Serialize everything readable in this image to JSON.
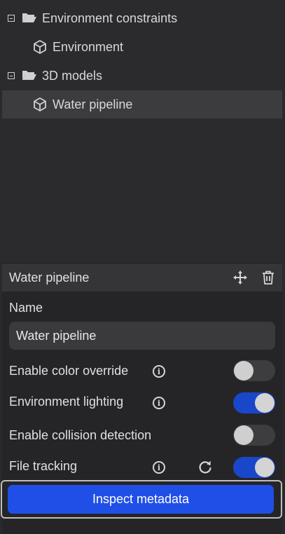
{
  "tree": {
    "items": [
      {
        "label": "Environment constraints",
        "kind": "folder",
        "expanded": true,
        "icon": "folder-open-icon"
      },
      {
        "label": "Environment",
        "kind": "model",
        "icon": "cube-icon"
      },
      {
        "label": "3D models",
        "kind": "folder",
        "expanded": true,
        "icon": "folder-open-icon"
      },
      {
        "label": "Water pipeline",
        "kind": "model",
        "selected": true,
        "icon": "cube-icon"
      }
    ]
  },
  "properties": {
    "title": "Water pipeline",
    "header_icons": [
      "move-icon",
      "trash-icon"
    ],
    "name_label": "Name",
    "name_value": "Water pipeline",
    "toggles": [
      {
        "label": "Enable color override",
        "info": true,
        "on": false
      },
      {
        "label": "Environment lighting",
        "info": true,
        "on": true
      },
      {
        "label": "Enable collision detection",
        "info": false,
        "on": false
      },
      {
        "label": "File tracking",
        "info": true,
        "refresh": true,
        "on": true
      }
    ],
    "inspect_button": "Inspect metadata"
  },
  "colors": {
    "accent": "#1f4fe6",
    "toggle_on": "#1a47c9",
    "selected_row": "#3c3c3e"
  }
}
